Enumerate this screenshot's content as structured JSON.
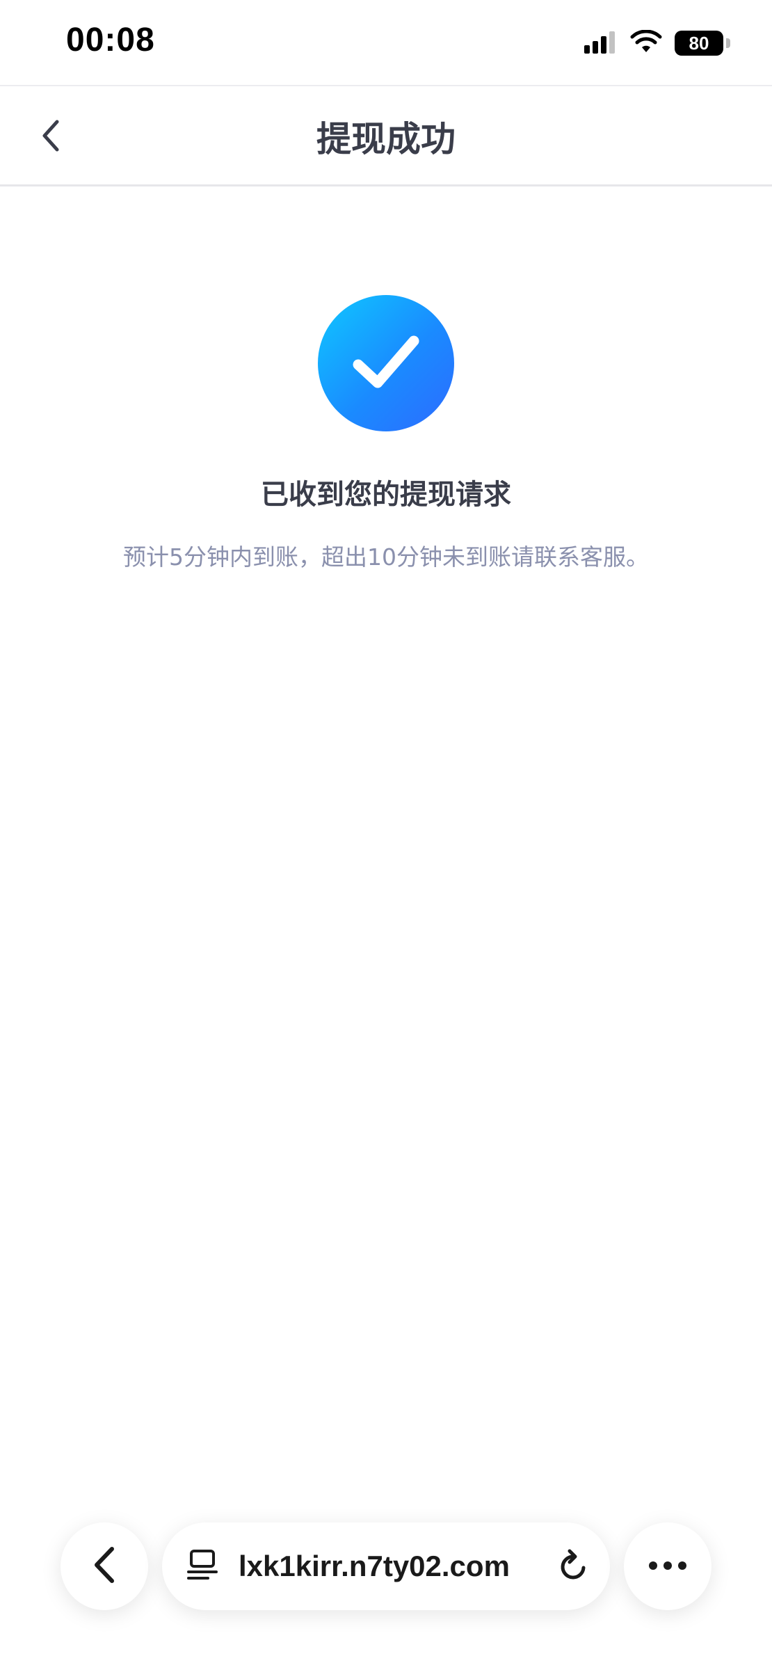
{
  "status_bar": {
    "time": "00:08",
    "battery": "80",
    "signal_icon": "cellular-signal-icon",
    "wifi_icon": "wifi-icon"
  },
  "header": {
    "title": "提现成功",
    "back_icon": "chevron-left-icon"
  },
  "result": {
    "icon": "checkmark-circle-icon",
    "title": "已收到您的提现请求",
    "description": "预计5分钟内到账，超出10分钟未到账请联系客服。",
    "accent_color": "#1a8bff"
  },
  "browser_bar": {
    "back_icon": "chevron-left-icon",
    "tab_icon": "tabs-icon",
    "url": "lxk1kirr.n7ty02.com",
    "reload_icon": "reload-icon",
    "more_icon": "more-dots-icon"
  }
}
